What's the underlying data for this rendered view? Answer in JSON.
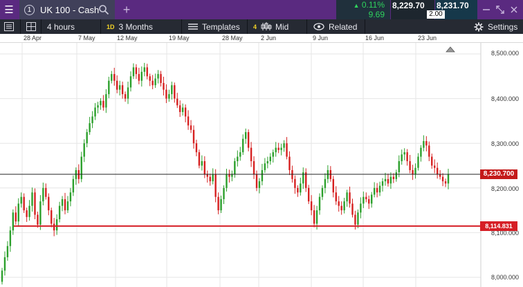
{
  "topbar": {
    "menu_icon": "hamburger-icon",
    "instrument_number": "1",
    "instrument_name": "UK 100 - Cash",
    "add_tab_label": "+",
    "change_percent": "0.11%",
    "change_points": "9.69",
    "sell_price": "8,229.70",
    "buy_price": "8,231.70",
    "spread": "2.00"
  },
  "toolbar": {
    "interval": "4 hours",
    "range_badge": "1D",
    "range": "3 Months",
    "templates": "Templates",
    "indicator_count": "4",
    "price_type": "Mid",
    "related": "Related",
    "settings": "Settings"
  },
  "colors": {
    "up": "#2ca02c",
    "down": "#d62020",
    "level_line": "#d61f26",
    "current_line": "#222222",
    "topbar": "#5a2a80"
  },
  "chart_data": {
    "type": "candlestick",
    "x_ticks": [
      "28 Apr",
      "7 May",
      "12 May",
      "19 May",
      "28 May",
      "2 Jun",
      "9 Jun",
      "16 Jun",
      "23 Jun"
    ],
    "y_ticks": [
      "8,500.000",
      "8,400.000",
      "8,300.000",
      "8,200.000",
      "8,100.000",
      "8,000.000"
    ],
    "ylim": [
      7990,
      8515
    ],
    "current_price": 8230.7,
    "current_price_label": "8,230.700",
    "level_price": 8114.831,
    "level_price_label": "8,114.831",
    "closes": [
      8015,
      8045,
      8070,
      8105,
      8145,
      8125,
      8165,
      8180,
      8150,
      8135,
      8160,
      8190,
      8140,
      8118,
      8170,
      8200,
      8180,
      8150,
      8120,
      8105,
      8130,
      8160,
      8175,
      8150,
      8170,
      8190,
      8220,
      8240,
      8220,
      8270,
      8300,
      8325,
      8345,
      8360,
      8380,
      8385,
      8395,
      8380,
      8410,
      8440,
      8455,
      8440,
      8420,
      8430,
      8410,
      8400,
      8425,
      8450,
      8470,
      8455,
      8440,
      8460,
      8470,
      8450,
      8440,
      8430,
      8445,
      8455,
      8435,
      8420,
      8400,
      8410,
      8430,
      8400,
      8385,
      8370,
      8380,
      8360,
      8340,
      8330,
      8300,
      8280,
      8250,
      8260,
      8230,
      8225,
      8215,
      8230,
      8180,
      8150,
      8175,
      8200,
      8230,
      8225,
      8230,
      8260,
      8270,
      8280,
      8310,
      8325,
      8290,
      8260,
      8230,
      8200,
      8215,
      8240,
      8255,
      8260,
      8270,
      8280,
      8290,
      8285,
      8290,
      8300,
      8270,
      8240,
      8220,
      8200,
      8190,
      8210,
      8235,
      8200,
      8170,
      8150,
      8120,
      8150,
      8180,
      8200,
      8220,
      8240,
      8220,
      8190,
      8170,
      8160,
      8150,
      8170,
      8190,
      8165,
      8140,
      8118,
      8145,
      8165,
      8180,
      8175,
      8165,
      8185,
      8200,
      8190,
      8205,
      8215,
      8220,
      8210,
      8225,
      8220,
      8235,
      8260,
      8275,
      8280,
      8260,
      8240,
      8230,
      8245,
      8270,
      8290,
      8305,
      8295,
      8270,
      8250,
      8245,
      8230,
      8225,
      8215,
      8210,
      8230
    ]
  }
}
